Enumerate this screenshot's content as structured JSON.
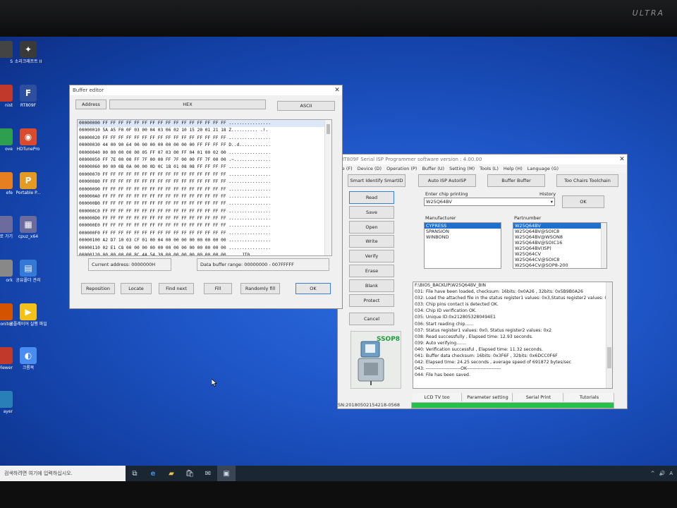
{
  "monitor": {
    "brand": "ULTRA"
  },
  "desktop_icons": [
    {
      "label": "소리크래프트 II",
      "icon": "app-icon",
      "color": "#3a3a3a"
    },
    {
      "label": "RT809F",
      "icon": "fix-icon",
      "color": "#2d4f9e"
    },
    {
      "label": "HDTunePro",
      "icon": "hdtune-icon",
      "color": "#d94b2c"
    },
    {
      "label": "Portable P...",
      "icon": "portable-icon",
      "color": "#e59a22"
    },
    {
      "label": "cpuz_x64",
      "icon": "cpuz-icon",
      "color": "#6b6b9e"
    },
    {
      "label": "공유폴더 관리",
      "icon": "folder-share-icon",
      "color": "#3479d6"
    },
    {
      "label": "곰플레이어 실행 파일",
      "icon": "player-icon",
      "color": "#f2c21b"
    },
    {
      "label": "크롬북",
      "icon": "chrome-icon",
      "color": "#4a8cf0"
    },
    {
      "label": "리기",
      "icon": "left-app-1-icon",
      "color": "#5b5b5b"
    },
    {
      "label": "Fix",
      "icon": "left-app-2-icon",
      "color": "#2e9e4f"
    }
  ],
  "left_partial_icons": [
    "S",
    "nist",
    "ove",
    "efe",
    "으로 가기",
    "ork",
    "PU Monitor",
    "ViewViewer",
    "ayer"
  ],
  "buffer_editor": {
    "title": "Buffer editor",
    "col_address": "Address",
    "col_hex": "HEX",
    "col_ascii": "ASCII",
    "rows": [
      "00000000 FF FF FF FF FF FF FF FF FF FF FF FF FF FF FF FF ................",
      "00000010 5A A5 F0 0F 03 00 04 03 06 02 10 15 20 01 21 18 Z.......... .!.",
      "00000020 FF FF FF FF FF FF FF FF FF FF FF FF FF FF FF FF ................",
      "00000030 44 00 90 64 00 00 00 00 00 00 00 00 FF FF FF FF D..d............",
      "00000040 00 00 00 00 00 05 FF 07 03 00 FF 04 01 00 02 00 ................",
      "00000050 FF 7E 00 00 FF 7F 00 00 FF 7F 00 00 FF 7F 00 00 .~..............",
      "00000060 00 00 0B 0A 00 00 0D 0C 18 01 08 08 FF FF FF FF ................",
      "00000070 FF FF FF FF FF FF FF FF FF FF FF FF FF FF FF FF ................",
      "00000080 FF FF FF FF FF FF FF FF FF FF FF FF FF FF FF FF ................",
      "00000090 FF FF FF FF FF FF FF FF FF FF FF FF FF FF FF FF ................",
      "000000A0 FF FF FF FF FF FF FF FF FF FF FF FF FF FF FF FF ................",
      "000000B0 FF FF FF FF FF FF FF FF FF FF FF FF FF FF FF FF ................",
      "000000C0 FF FF FF FF FF FF FF FF FF FF FF FF FF FF FF FF ................",
      "000000D0 FF FF FF FF FF FF FF FF FF FF FF FF FF FF FF FF ................",
      "000000E0 FF FF FF FF FF FF FF FF FF FF FF FF FF FF FF FF ................",
      "000000F0 FF FF FF FF FF FF FF FF FF FF FF FF FF FF FF FF ................",
      "00000100 A2 D7 10 03 CF 01 00 04 00 00 00 00 00 00 00 00 ................",
      "00000110 02 E1 C8 00 00 00 00 00 00 00 00 00 00 00 00 00 ................",
      "00000120 00 00 00 00 8C 4A 54 30 00 00 00 00 00 00 00 00 .....JT0........"
    ],
    "current_address": "Current address: 0000000H",
    "buffer_range": "Data buffer range: 00000000 - 007FFFFF",
    "buttons": {
      "reposition": "Reposition",
      "locate": "Locate",
      "find_next": "Find next",
      "fill": "Fill",
      "random": "Randomly fill",
      "ok": "OK"
    }
  },
  "programmer": {
    "title": "RT809F Serial ISP Programmer software version : 4.00.00",
    "menu": [
      "le (F)",
      "Device (D)",
      "Operation (P)",
      "Buffer (U)",
      "Setting (M)",
      "Tools (L)",
      "Help (H)",
      "Language (G)"
    ],
    "tabs": [
      "Smart Identify SmartID",
      "Auto ISP AutoISP",
      "Buffer Buffer",
      "Too Chairs Toolchain"
    ],
    "side_buttons": [
      "Read",
      "Save",
      "Open",
      "Write",
      "Verify",
      "Erase",
      "Blank",
      "Protect",
      "Cancel"
    ],
    "chip_label": "Enter chip printing",
    "chip_value": "W25Q64BV",
    "history_label": "History",
    "ok_button": "OK",
    "manufacturer_label": "Manufacturer",
    "manufacturers": [
      "CYPRESS",
      "SPANSION",
      "WINBOND"
    ],
    "partnumber_label": "Partnumber",
    "partnumbers": [
      "W25Q64BV",
      "W25Q64BV@SOIC8",
      "W25Q64BV@WSON8",
      "W25Q64BV@SOIC16",
      "W25Q64BV(ISP)",
      "W25Q64CV",
      "W25Q64CV@SOIC8",
      "W25Q64CV@SOP8-200"
    ],
    "package_label": "SSOP8",
    "log": [
      "F:\\BIOS_BACKUP\\W25Q64BV_BIN",
      "031: File have been loaded, checksum: 16bits: 0x0A26 , 32bits: 0x5B9B0A26",
      "032: Load the attached file in the status register1 values: 0x3,Status register2 values: 0x",
      "033: Chip pins contact is detected OK.",
      "034: Chip ID verification OK.",
      "035: Unique ID:0x2128053280494E1",
      "036: Start reading chip......",
      "037: Status register1 values: 0x0, Status register2 values: 0x2",
      "038: Read successfully , Elapsed time: 12.93 seconds.",
      "039: Auto verifying.......",
      "040: Verification successful , Elapsed time: 11.32 seconds.",
      "041: Buffer data checksum: 16bits: 0x3F6F , 32bits: 0x6DCC0F6F",
      "042: Elapsed time: 24.25 seconds , average speed of 691872 bytes/sec",
      "043: ----------------------OK----------------------",
      "044: File has been saved."
    ],
    "bottom_tabs": [
      "LCD TV too",
      "Parameter setting",
      "Serial Print",
      "Tutorials"
    ],
    "serial": "SN:20180502154218-0568",
    "progress_percent": 100,
    "progress_color": "#23c04a"
  },
  "taskbar": {
    "search_placeholder": "검색하려면 여기에 입력하십시오.",
    "icons": [
      "task-view-icon",
      "edge-icon",
      "file-explorer-icon",
      "store-icon",
      "mail-icon",
      "rt809f-taskbar-icon"
    ],
    "tray_chevron": "^",
    "tray_lang": "A"
  },
  "colors": {
    "accent": "#1f6fd1",
    "taskbar": "#1b2633"
  }
}
